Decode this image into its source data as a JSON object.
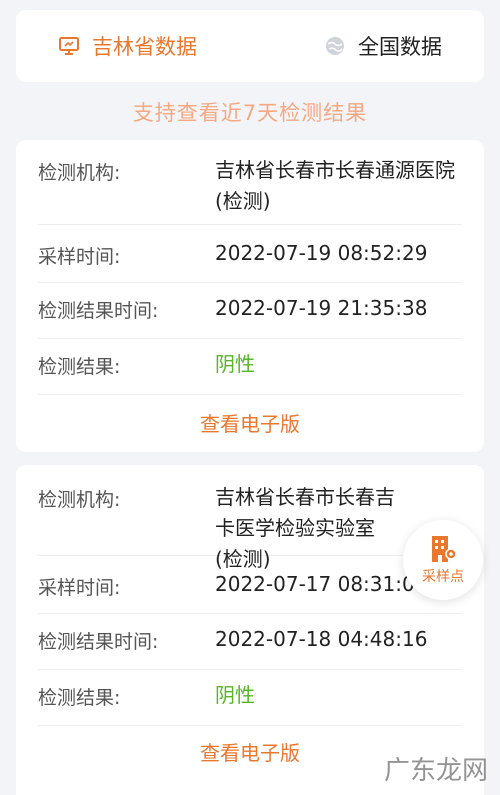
{
  "tabs": {
    "left": {
      "label": "吉林省数据",
      "icon": "monitor-icon"
    },
    "right": {
      "label": "全国数据",
      "icon": "globe-icon"
    }
  },
  "notice": "支持查看近7天检测结果",
  "records": [
    {
      "institution_label": "检测机构:",
      "institution": "吉林省长春市长春通源医院(检测)",
      "sample_time_label": "采样时间:",
      "sample_time": "2022-07-19 08:52:29",
      "result_time_label": "检测结果时间:",
      "result_time": "2022-07-19 21:35:38",
      "result_label": "检测结果:",
      "result": "阴性",
      "view_label": "查看电子版"
    },
    {
      "institution_label": "检测机构:",
      "institution": "吉林省长春市长春吉卡医学检验实验室(检测)",
      "sample_time_label": "采样时间:",
      "sample_time": "2022-07-17 08:31:0",
      "result_time_label": "检测结果时间:",
      "result_time": "2022-07-18 04:48:16",
      "result_label": "检测结果:",
      "result": "阴性",
      "view_label": "查看电子版"
    }
  ],
  "fab": {
    "label": "采样点",
    "icon": "building-pin-icon"
  },
  "watermark": "广东龙网",
  "colors": {
    "accent": "#e8782e",
    "negative": "#58b42b",
    "notice": "#f5a882"
  }
}
